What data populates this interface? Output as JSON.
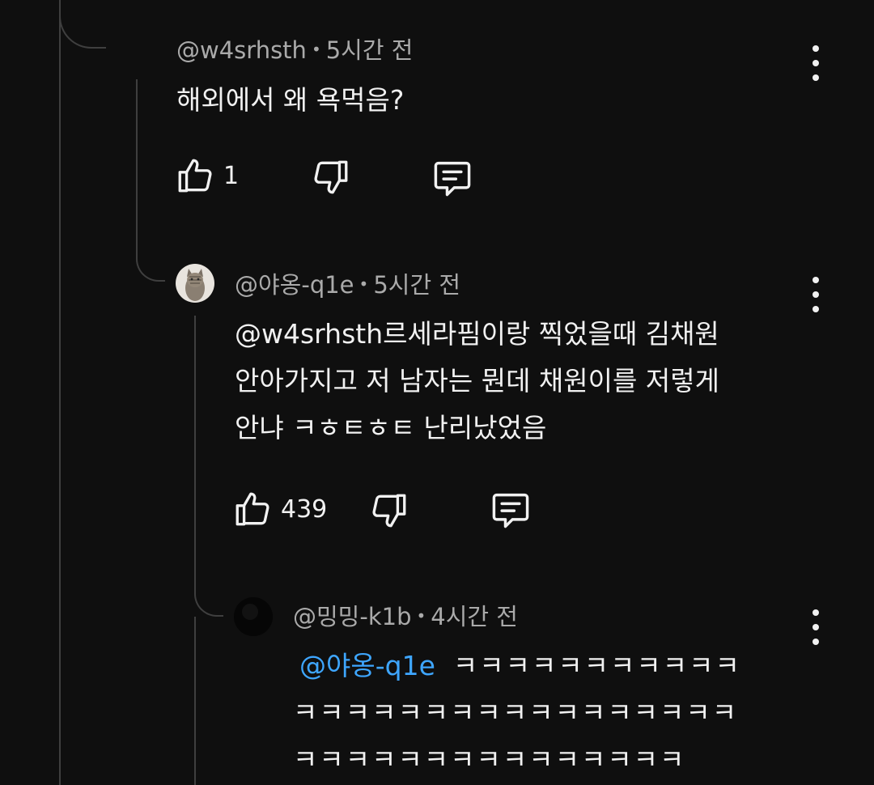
{
  "comments": [
    {
      "author": "@w4srhsth",
      "time": "5시간 전",
      "lines": [
        "해외에서 왜 욕먹음?"
      ],
      "likes": "1"
    },
    {
      "author": "@야옹-q1e",
      "time": "5시간 전",
      "lines": [
        "@w4srhsth르세라핌이랑 찍었을때 김채원",
        "안아가지고 저 남자는 뭔데 채원이를 저렇게",
        "안냐 ㅋㅎㅌㅎㅌ 난리났었음"
      ],
      "likes": "439"
    },
    {
      "author": "@밍밍-k1b",
      "time": "4시간 전",
      "mention": "@야옹-q1e",
      "lines": [
        "ㅋㅋㅋㅋㅋㅋㅋㅋㅋㅋㅋ",
        "ㅋㅋㅋㅋㅋㅋㅋㅋㅋㅋㅋㅋㅋㅋㅋㅋㅋ",
        "ㅋㅋㅋㅋㅋㅋㅋㅋㅋㅋㅋㅋㅋㅋㅋ"
      ]
    }
  ],
  "meta_separator": "•",
  "icons": {
    "like": "thumbs-up-icon",
    "dislike": "thumbs-down-icon",
    "reply": "comment-icon",
    "more": "more-vertical-icon"
  },
  "colors": {
    "background": "#0f0f0f",
    "text": "#f1f1f1",
    "meta": "#aaaaaa",
    "mention": "#3ea6ff",
    "thread_line": "#3f3f3f"
  }
}
